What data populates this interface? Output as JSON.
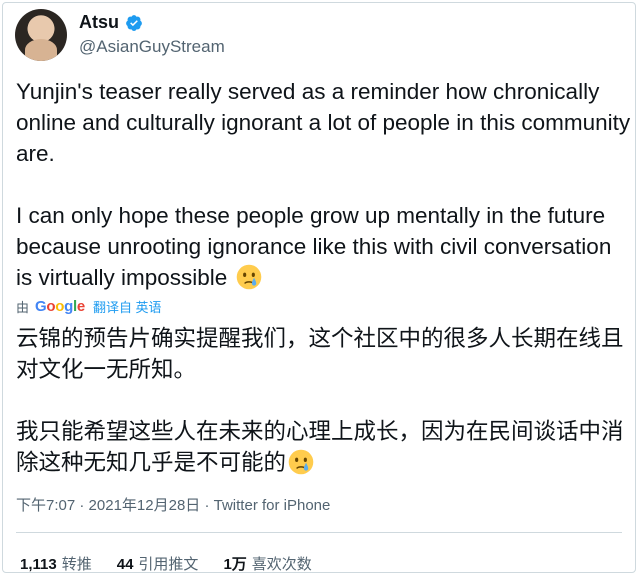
{
  "user": {
    "name": "Atsu",
    "handle": "@AsianGuyStream"
  },
  "tweet": {
    "paragraph1": "Yunjin's teaser really served as a reminder how chronically online and culturally ignorant a lot of people in this community are.",
    "paragraph2": "I can only hope these people grow up mentally in the future because unrooting ignorance like this with civil conversation is virtually impossible",
    "emoji": "crying-face"
  },
  "translation": {
    "by": "由",
    "provider": "Google",
    "link": "翻译自 英语",
    "paragraph1": "云锦的预告片确实提醒我们，这个社区中的很多人长期在线且对文化一无所知。",
    "paragraph2": "我只能希望这些人在未来的心理上成长，因为在民间谈话中消除这种无知几乎是不可能的"
  },
  "meta": {
    "time": "下午7:07",
    "sep1": " · ",
    "date": "2021年12月28日",
    "sep2": " · ",
    "source": "Twitter for iPhone"
  },
  "stats": [
    {
      "value": "1,113",
      "label": "转推"
    },
    {
      "value": "44",
      "label": "引用推文"
    },
    {
      "value": "1万",
      "label": "喜欢次数"
    }
  ],
  "colors": {
    "verified": "#1d9bf0",
    "link": "#1d9bf0",
    "secondary_text": "#536471"
  }
}
